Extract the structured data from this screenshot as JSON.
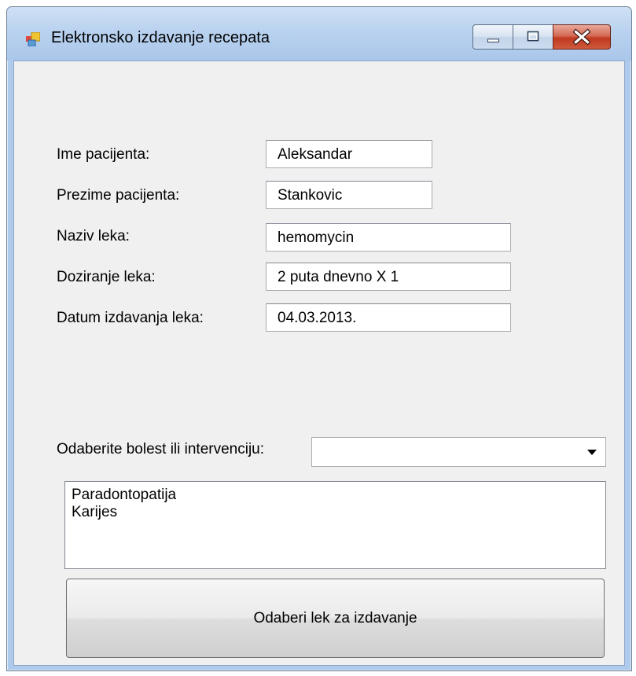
{
  "window": {
    "title": "Elektronsko izdavanje recepata"
  },
  "form": {
    "fields": [
      {
        "label": "Ime pacijenta:",
        "value": "Aleksandar"
      },
      {
        "label": "Prezime pacijenta:",
        "value": "Stankovic"
      },
      {
        "label": "Naziv leka:",
        "value": "hemomycin"
      },
      {
        "label": "Doziranje leka:",
        "value": "2 puta dnevno X 1"
      },
      {
        "label": "Datum izdavanja leka:",
        "value": "04.03.2013."
      }
    ],
    "combo_label": "Odaberite bolest ili intervenciju:",
    "combo_value": "",
    "list_items": [
      "Paradontopatija",
      "Karijes"
    ],
    "button_label": "Odaberi lek za izdavanje"
  },
  "icons": {
    "app": "window-app-icon",
    "minimize": "minimize-icon",
    "maximize": "maximize-icon",
    "close": "close-icon",
    "dropdown": "chevron-down-icon"
  },
  "colors": {
    "frame": "#aecaec",
    "client": "#f0f0f0",
    "close_button": "#c0391f"
  }
}
